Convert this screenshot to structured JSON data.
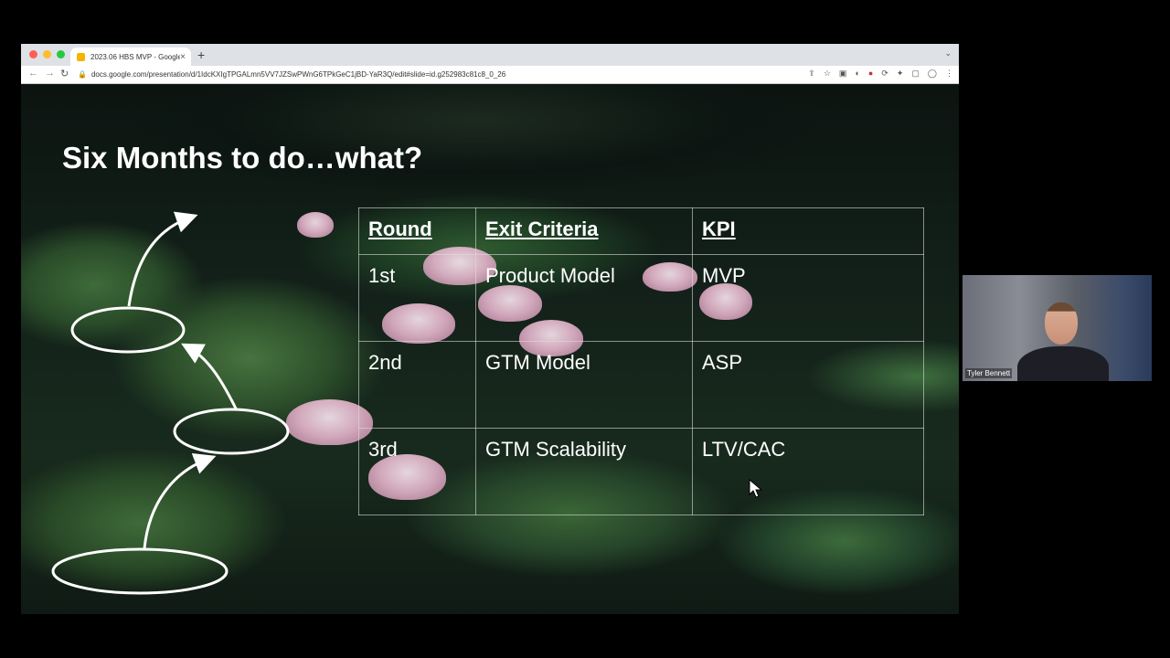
{
  "browser": {
    "tab_title": "2023.06 HBS MVP - Google Sl",
    "tab_close": "×",
    "new_tab": "+",
    "tab_menu": "⌄",
    "url": "docs.google.com/presentation/d/1IdcKXIgTPGALmn5VV7JZSwPWnG6TPkGeC1jBD-YaR3Q/edit#slide=id.g252983c81c8_0_26",
    "back": "←",
    "forward": "→",
    "reload": "↻",
    "lock": "🔒",
    "traffic_light_colors": [
      "#ff5f57",
      "#febc2e",
      "#28c840"
    ],
    "toolbar_icons": [
      "⇪",
      "☆",
      "▣",
      "◐",
      "●",
      "⟳",
      "✦",
      "▢",
      "◯",
      "⋮"
    ]
  },
  "slide": {
    "title": "Six Months to do…what?",
    "table": {
      "headers": [
        "Round",
        "Exit Criteria",
        "KPI"
      ],
      "rows": [
        [
          "1st",
          "Product Model",
          "MVP"
        ],
        [
          "2nd",
          "GTM Model",
          "ASP"
        ],
        [
          "3rd",
          "GTM Scalability",
          "LTV/CAC"
        ]
      ]
    }
  },
  "video": {
    "participant_name": "Tyler Bennett"
  }
}
